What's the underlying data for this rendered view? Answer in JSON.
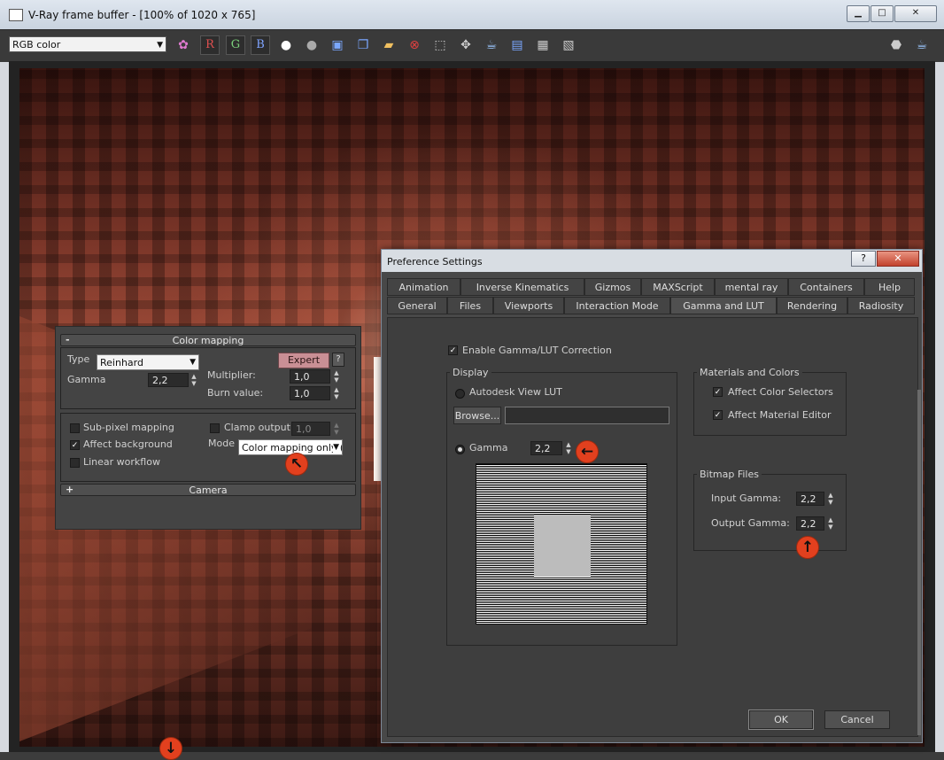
{
  "frame_buffer": {
    "title": "V-Ray frame buffer - [100% of 1020 x 765]",
    "window_buttons": {
      "minimize": "▁",
      "maximize": "□",
      "close": "✕"
    },
    "channel": "RGB color",
    "toolbar": {
      "r_label": "R",
      "g_label": "G",
      "b_label": "B"
    }
  },
  "color_mapping": {
    "header": "Color mapping",
    "header_sign": "-",
    "type_label": "Type",
    "type_value": "Reinhard",
    "expert_label": "Expert",
    "help_label": "?",
    "gamma_label": "Gamma",
    "gamma_value": "2,2",
    "multiplier_label": "Multiplier:",
    "multiplier_value": "1,0",
    "burn_label": "Burn value:",
    "burn_value": "1,0",
    "subpixel_label": "Sub-pixel mapping",
    "clamp_label": "Clamp output",
    "clamp_value": "1,0",
    "affect_bg_label": "Affect background",
    "mode_label": "Mode",
    "mode_value": "Color mapping only (",
    "linear_label": "Linear workflow",
    "camera_header": "Camera",
    "camera_sign": "+"
  },
  "pref": {
    "title": "Preference Settings",
    "help_btn": "?",
    "close_btn": "✕",
    "tabs_row1": [
      "Animation",
      "Inverse Kinematics",
      "Gizmos",
      "MAXScript",
      "mental ray",
      "Containers",
      "Help"
    ],
    "tabs_row2": [
      "General",
      "Files",
      "Viewports",
      "Interaction Mode",
      "Gamma and LUT",
      "Rendering",
      "Radiosity"
    ],
    "enable_label": "Enable Gamma/LUT Correction",
    "display_title": "Display",
    "autodesk_lut": "Autodesk View LUT",
    "browse": "Browse...",
    "gamma_label": "Gamma",
    "gamma_value": "2,2",
    "materials_title": "Materials and Colors",
    "affect_selectors": "Affect Color Selectors",
    "affect_editor": "Affect Material Editor",
    "bitmap_title": "Bitmap Files",
    "input_gamma_label": "Input Gamma:",
    "input_gamma_value": "2,2",
    "output_gamma_label": "Output Gamma:",
    "output_gamma_value": "2,2",
    "ok": "OK",
    "cancel": "Cancel"
  }
}
